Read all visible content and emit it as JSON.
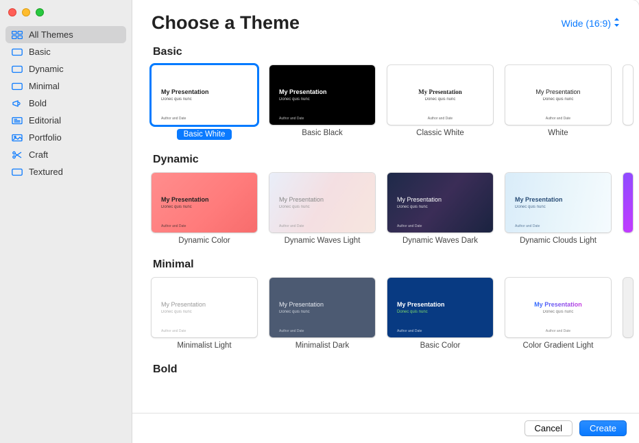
{
  "header": {
    "title": "Choose a Theme",
    "aspect_label": "Wide (16:9)"
  },
  "sidebar": {
    "items": [
      {
        "label": "All Themes"
      },
      {
        "label": "Basic"
      },
      {
        "label": "Dynamic"
      },
      {
        "label": "Minimal"
      },
      {
        "label": "Bold"
      },
      {
        "label": "Editorial"
      },
      {
        "label": "Portfolio"
      },
      {
        "label": "Craft"
      },
      {
        "label": "Textured"
      }
    ]
  },
  "thumb_text": {
    "title": "My Presentation",
    "subtitle": "Donec quis nunc",
    "author": "Author and Date"
  },
  "sections": {
    "basic": {
      "title": "Basic",
      "themes": [
        {
          "label": "Basic White"
        },
        {
          "label": "Basic Black"
        },
        {
          "label": "Classic White"
        },
        {
          "label": "White"
        }
      ]
    },
    "dynamic": {
      "title": "Dynamic",
      "themes": [
        {
          "label": "Dynamic Color"
        },
        {
          "label": "Dynamic Waves Light"
        },
        {
          "label": "Dynamic Waves Dark"
        },
        {
          "label": "Dynamic Clouds Light"
        }
      ]
    },
    "minimal": {
      "title": "Minimal",
      "themes": [
        {
          "label": "Minimalist Light"
        },
        {
          "label": "Minimalist Dark"
        },
        {
          "label": "Basic Color"
        },
        {
          "label": "Color Gradient Light"
        }
      ]
    },
    "bold": {
      "title": "Bold"
    }
  },
  "footer": {
    "cancel": "Cancel",
    "create": "Create"
  }
}
